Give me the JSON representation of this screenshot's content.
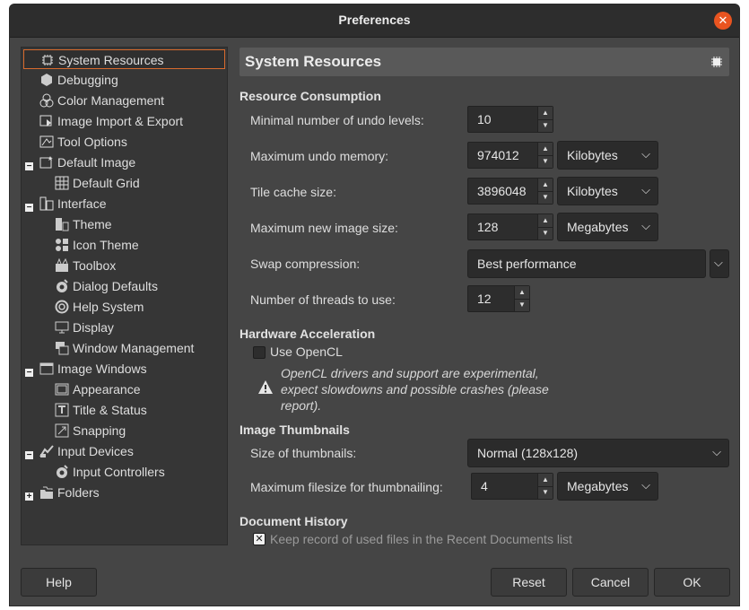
{
  "window": {
    "title": "Preferences"
  },
  "sidebar": {
    "items": [
      {
        "label": "System Resources",
        "icon": "chip-icon",
        "selected": true
      },
      {
        "label": "Debugging",
        "icon": "debug-icon"
      },
      {
        "label": "Color Management",
        "icon": "color-icon"
      },
      {
        "label": "Image Import & Export",
        "icon": "import-export-icon"
      },
      {
        "label": "Tool Options",
        "icon": "tool-options-icon"
      },
      {
        "label": "Default Image",
        "icon": "default-image-icon"
      },
      {
        "label": "Default Grid",
        "icon": "grid-icon"
      },
      {
        "label": "Interface",
        "icon": "interface-icon"
      },
      {
        "label": "Theme",
        "icon": "theme-icon"
      },
      {
        "label": "Icon Theme",
        "icon": "icon-theme-icon"
      },
      {
        "label": "Toolbox",
        "icon": "toolbox-icon"
      },
      {
        "label": "Dialog Defaults",
        "icon": "dialog-defaults-icon"
      },
      {
        "label": "Help System",
        "icon": "help-system-icon"
      },
      {
        "label": "Display",
        "icon": "display-icon"
      },
      {
        "label": "Window Management",
        "icon": "window-management-icon"
      },
      {
        "label": "Image Windows",
        "icon": "image-windows-icon"
      },
      {
        "label": "Appearance",
        "icon": "appearance-icon"
      },
      {
        "label": "Title & Status",
        "icon": "title-status-icon"
      },
      {
        "label": "Snapping",
        "icon": "snapping-icon"
      },
      {
        "label": "Input Devices",
        "icon": "input-devices-icon"
      },
      {
        "label": "Input Controllers",
        "icon": "input-controllers-icon"
      },
      {
        "label": "Folders",
        "icon": "folders-icon"
      }
    ]
  },
  "panel": {
    "title": "System Resources",
    "resource": {
      "title": "Resource Consumption",
      "undo_levels": {
        "label": "Minimal number of undo levels:",
        "value": "10"
      },
      "undo_memory": {
        "label": "Maximum undo memory:",
        "value": "974012",
        "unit": "Kilobytes"
      },
      "tile_cache": {
        "label": "Tile cache size:",
        "value": "3896048",
        "unit": "Kilobytes"
      },
      "new_image": {
        "label": "Maximum new image size:",
        "value": "128",
        "unit": "Megabytes"
      },
      "swap": {
        "label": "Swap compression:",
        "value": "Best performance"
      },
      "threads": {
        "label": "Number of threads to use:",
        "value": "12"
      }
    },
    "hardware": {
      "title": "Hardware Acceleration",
      "opencl": {
        "label": "Use OpenCL",
        "checked": false
      },
      "warning": "OpenCL drivers and support are experimental, expect slowdowns and possible crashes (please report)."
    },
    "thumbnails": {
      "title": "Image Thumbnails",
      "size": {
        "label": "Size of thumbnails:",
        "value": "Normal (128x128)"
      },
      "filesize": {
        "label": "Maximum filesize for thumbnailing:",
        "value": "4",
        "unit": "Megabytes"
      }
    },
    "history": {
      "title": "Document History",
      "keep": {
        "label": "Keep record of used files in the Recent Documents list",
        "checked": true
      }
    }
  },
  "buttons": {
    "help": "Help",
    "reset": "Reset",
    "cancel": "Cancel",
    "ok": "OK"
  },
  "colors": {
    "accent": "#e95420",
    "selection_border": "#d96b2e",
    "window_bg": "#454545"
  }
}
